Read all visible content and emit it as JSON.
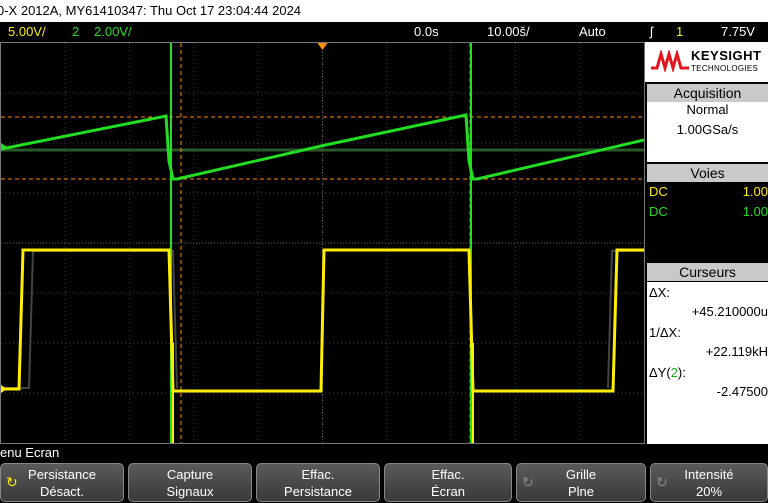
{
  "window_title": "0-X 2012A, MY61410347: Thu Oct 17 23:04:44 2024",
  "status": {
    "ch1_scale": "5.00V/",
    "ch2_num": "2",
    "ch2_scale": "2.00V/",
    "time_delay": "0.0s",
    "time_scale": "10.00š/",
    "trigger_mode": "Auto",
    "trigger_icon": "ʃ",
    "trigger_source": "1",
    "trigger_level": "7.75V"
  },
  "brand": {
    "name": "KEYSIGHT",
    "sub": "TECHNOLOGIES"
  },
  "acquisition": {
    "header": "Acquisition",
    "mode": "Normal",
    "rate": "1.00GSa/s"
  },
  "channels": {
    "header": "Voies",
    "list": [
      {
        "coupling": "DC",
        "value": "1.00",
        "color": "#ffee00"
      },
      {
        "coupling": "DC",
        "value": "1.00",
        "color": "#22dd22"
      }
    ]
  },
  "cursors": {
    "header": "Curseurs",
    "dx_label": "ΔX:",
    "dx_value": "+45.210000u",
    "inv_dx_label": "1/ΔX:",
    "inv_dx_value": "+22.119kH",
    "dy_label_pre": "ΔY(",
    "dy_channel": "2",
    "dy_label_post": "):",
    "dy_value": "-2.47500"
  },
  "menu_label": "enu Ecran",
  "softkeys": [
    {
      "line1": "Persistance",
      "line2": "Désact.",
      "icon": "↻"
    },
    {
      "line1": "Capture",
      "line2": "Signaux",
      "icon": ""
    },
    {
      "line1": "Effac.",
      "line2": "Persistance",
      "icon": ""
    },
    {
      "line1": "Effac.",
      "line2": "Écran",
      "icon": ""
    },
    {
      "line1": "Grille",
      "line2": "Plne",
      "icon": "↻"
    },
    {
      "line1": "Intensité",
      "line2": "20%",
      "icon": "↻"
    }
  ],
  "colors": {
    "ch1": "#ffee00",
    "ch2": "#22dd22",
    "cursor": "#ff8c00",
    "grid": "#3a3a3a"
  }
}
